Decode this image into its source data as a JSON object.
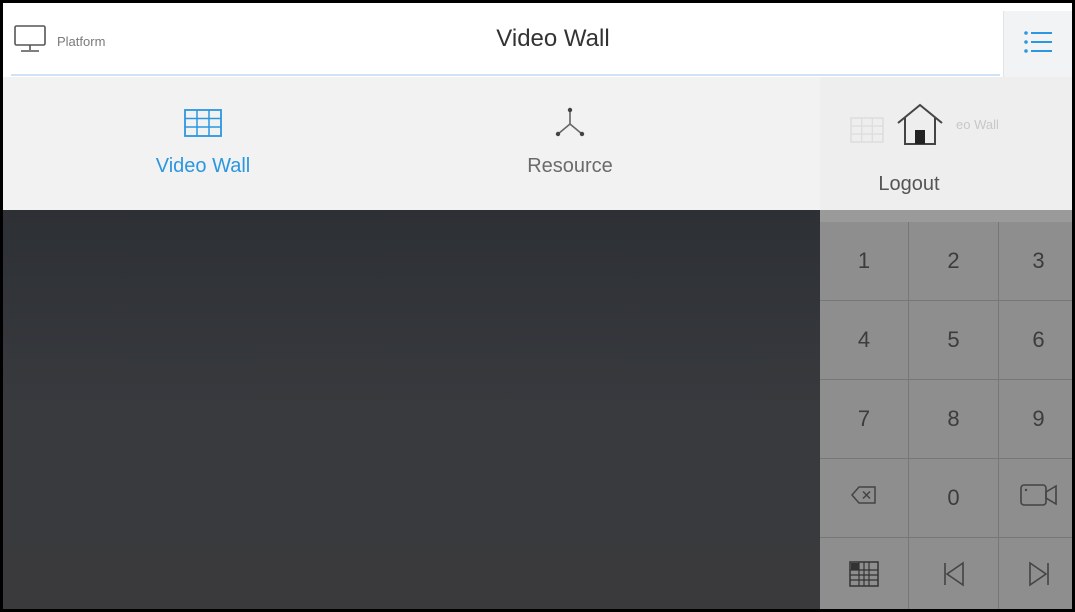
{
  "header": {
    "platform_label": "Platform",
    "title": "Video Wall",
    "menu_icon": "list-menu-icon",
    "platform_icon": "monitor-icon"
  },
  "nav": {
    "items": [
      {
        "label": "Video Wall",
        "icon": "grid-icon",
        "active": true
      },
      {
        "label": "Resource",
        "icon": "tree-branch-icon",
        "active": false
      }
    ]
  },
  "logout": {
    "label": "Logout",
    "icon": "home-icon",
    "ghost_text": "eo Wall"
  },
  "keypad": {
    "keys": [
      "1",
      "2",
      "3",
      "4",
      "5",
      "6",
      "7",
      "8",
      "9",
      "backspace-icon",
      "0",
      "camera-icon",
      "grid-layout-icon",
      "previous-icon",
      "next-icon"
    ],
    "digits": {
      "k1": "1",
      "k2": "2",
      "k3": "3",
      "k4": "4",
      "k5": "5",
      "k6": "6",
      "k7": "7",
      "k8": "8",
      "k9": "9",
      "k0": "0"
    }
  },
  "colors": {
    "accent": "#2a97e0",
    "nav_bg": "#f2f2f2",
    "keypad_bg": "#8e8e8e",
    "main_bg": "#35373b"
  }
}
